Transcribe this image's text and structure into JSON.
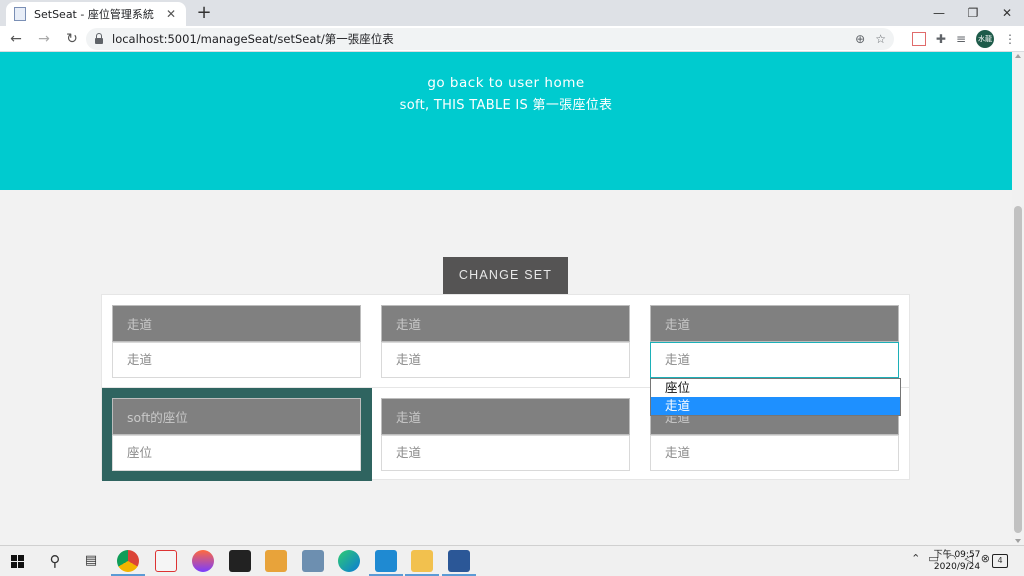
{
  "browser": {
    "tab_title": "SetSeat - 座位管理系統",
    "close_glyph": "✕",
    "new_tab_glyph": "+",
    "url": "localhost:5001/manageSeat/setSeat/第一張座位表",
    "avatar_text": "水龍",
    "window_controls": [
      "—",
      "❐",
      "✕"
    ]
  },
  "page": {
    "back_link": "go back to user home",
    "table_title": "soft, THIS TABLE IS 第一張座位表",
    "change_set_label": "CHANGE SET",
    "seats": [
      {
        "name": "走道",
        "type": "走道"
      },
      {
        "name": "走道",
        "type": "走道"
      },
      {
        "name": "走道",
        "type": "走道"
      },
      {
        "name": "soft的座位",
        "type": "座位"
      },
      {
        "name": "走道",
        "type": "走道"
      },
      {
        "name": "走道",
        "type": "走道"
      }
    ],
    "dropdown_options": [
      "座位",
      "走道"
    ],
    "dropdown_selected": "走道"
  },
  "taskbar": {
    "clock_time": "下午 09:57",
    "clock_date": "2020/9/24",
    "notification_count": "4"
  },
  "colors": {
    "hero": "#00cbcf",
    "highlight": "#2f6460",
    "button": "#555454",
    "selected_option": "#1e90ff"
  }
}
